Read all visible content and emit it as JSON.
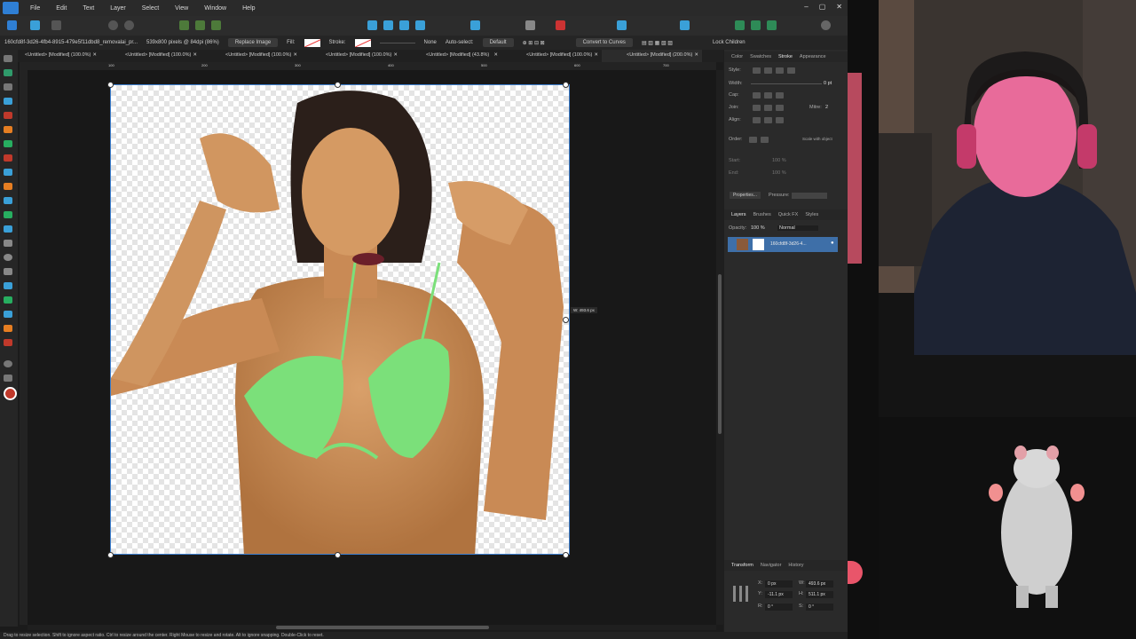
{
  "menu": [
    "File",
    "Edit",
    "Text",
    "Layer",
    "Select",
    "View",
    "Window",
    "Help"
  ],
  "context_bar": {
    "filename": "160cfd8f-3d26-4fb4-8915-479e5f11dbd8_removalai_pr...",
    "dimensions": "539x800 pixels @ 84dpi (86%)",
    "replace_image": "Replace Image",
    "fill_label": "Fill:",
    "stroke_label": "Stroke:",
    "stroke_none": "None",
    "auto_select": "Auto-select:",
    "auto_select_value": "Default",
    "convert_to_curves": "Convert to Curves",
    "lock_children": "Lock Children"
  },
  "tabs": [
    {
      "label": "<Untitled> [Modified] (100.0%)"
    },
    {
      "label": "<Untitled> [Modified] (100.0%)"
    },
    {
      "label": "<Untitled> [Modified] (100.0%)"
    },
    {
      "label": "<Untitled> [Modified] (100.0%)"
    },
    {
      "label": "<Untitled> [Modified] (43.8%)"
    },
    {
      "label": "<Untitled> [Modified] (100.0%)"
    },
    {
      "label": "<Untitled> [Modified] (200.0%)"
    }
  ],
  "ruler_ticks": [
    "100",
    "200",
    "300",
    "400",
    "500",
    "600",
    "700"
  ],
  "cursor_readout": "W: 493.6 px",
  "panel": {
    "tabs1": [
      "Color",
      "Swatches",
      "Stroke",
      "Appearance"
    ],
    "style_label": "Style:",
    "width_label": "Width:",
    "width_value": "0 pt",
    "cap_label": "Cap:",
    "join_label": "Join:",
    "mitre_label": "Mitre:",
    "mitre_value": "2",
    "align_label": "Align:",
    "order_label": "Order:",
    "scale_with_object": "Scale with object",
    "start_label": "Start:",
    "end_label": "End:",
    "start_pct": "100 %",
    "end_pct": "100 %",
    "properties_btn": "Properties...",
    "pressure_label": "Pressure:",
    "tabs2": [
      "Layers",
      "Brushes",
      "Quick FX",
      "Styles"
    ],
    "opacity_label": "Opacity:",
    "opacity_value": "100 %",
    "blend_mode": "Normal",
    "layer_name": "160cfd8f-3d26-4...",
    "tabs3": [
      "Transform",
      "Navigator",
      "History"
    ],
    "x_label": "X:",
    "x_value": "0 px",
    "y_label": "Y:",
    "y_value": "-11.1 px",
    "w_label": "W:",
    "w_value": "493.6 px",
    "h_label": "H:",
    "h_value": "511.1 px",
    "r_label": "R:",
    "r_value": "0 °",
    "s_label": "S:",
    "s_value": "0 °"
  },
  "status_bar": "Drag to resize selection. Shift to ignore aspect ratio. Ctrl to resize around the center. Right Mouse to resize and rotate. Alt to ignore snapping. Double-Click to reset.",
  "colors": {
    "accent": "#3d7fcf",
    "layer_selected": "#3e6fa8",
    "bikini": "#7be07a",
    "skin": "#c98a55"
  }
}
